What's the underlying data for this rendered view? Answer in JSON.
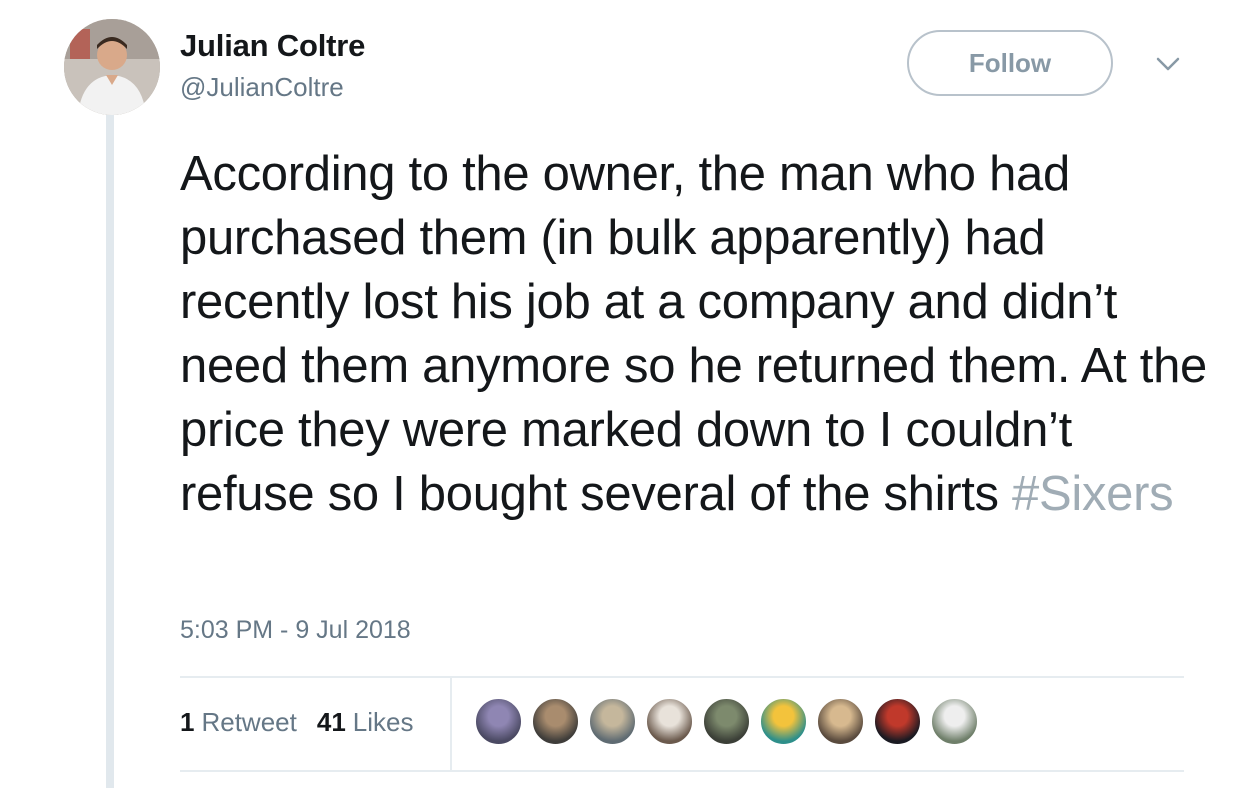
{
  "author": {
    "name": "Julian Coltre",
    "handle": "@JulianColtre",
    "avatar_icon": "profile-photo"
  },
  "header": {
    "follow_label": "Follow",
    "more_icon": "chevron-down-icon"
  },
  "tweet": {
    "text": "According to the owner, the man who had purchased them (in bulk apparently) had recently lost his job at a company and didn’t need them anymore so he returned them. At the price they were marked down to I couldn’t refuse so I bought several of the shirts ",
    "hashtag": "#Sixers",
    "timestamp": "5:03 PM - 9 Jul 2018"
  },
  "stats": {
    "retweets_count": "1",
    "retweets_label": "Retweet",
    "likes_count": "41",
    "likes_label": "Likes"
  },
  "likers": [
    {
      "colors": [
        "#4b4a63",
        "#8f86b3"
      ]
    },
    {
      "colors": [
        "#3f3d3a",
        "#a98c6e"
      ]
    },
    {
      "colors": [
        "#5f6b72",
        "#c5b79c"
      ]
    },
    {
      "colors": [
        "#6b5a4d",
        "#e8e2da"
      ]
    },
    {
      "colors": [
        "#3b3f37",
        "#7d8a6d"
      ]
    },
    {
      "colors": [
        "#2e8f8a",
        "#f3c33c"
      ]
    },
    {
      "colors": [
        "#5a4b3e",
        "#d7b98f"
      ]
    },
    {
      "colors": [
        "#1a1a22",
        "#c0392b"
      ]
    },
    {
      "colors": [
        "#6f7f6a",
        "#eeeeee"
      ]
    }
  ],
  "colors": {
    "text": "#14171a",
    "secondary": "#657786",
    "hashtag": "#a0acb5",
    "thread_line": "#e1e8ed"
  }
}
